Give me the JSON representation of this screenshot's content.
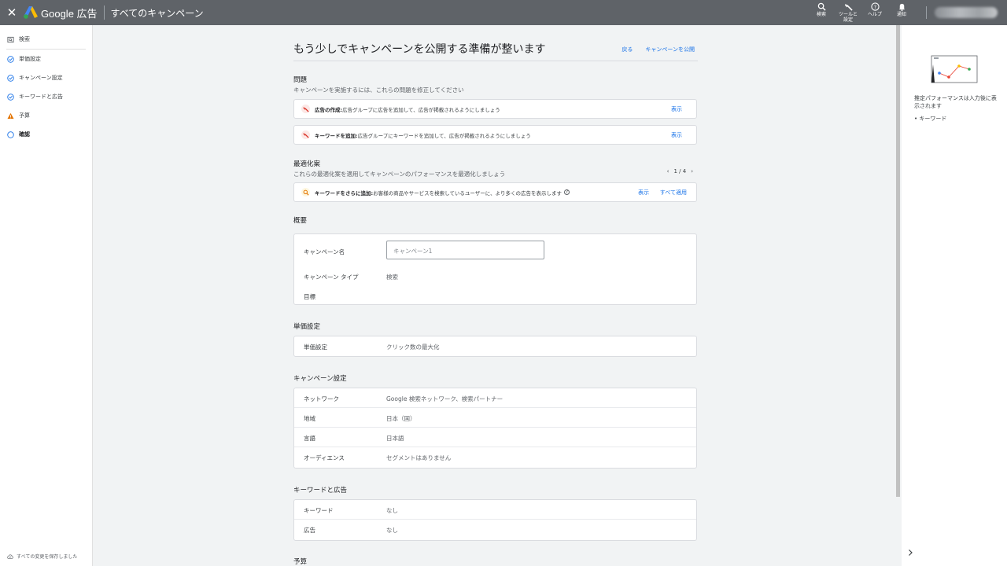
{
  "header": {
    "brand": "Google 広告",
    "title": "すべてのキャンペーン",
    "buttons": [
      {
        "line1": "検索",
        "line2": ""
      },
      {
        "line1": "ツールと",
        "line2": "設定"
      },
      {
        "line1": "ヘルプ",
        "line2": ""
      },
      {
        "line1": "通知",
        "line2": ""
      }
    ]
  },
  "nav": {
    "items": [
      {
        "label": "検索",
        "status": "search"
      },
      {
        "label": "単価設定",
        "status": "done"
      },
      {
        "label": "キャンペーン設定",
        "status": "done"
      },
      {
        "label": "キーワードと広告",
        "status": "done"
      },
      {
        "label": "予算",
        "status": "warning"
      },
      {
        "label": "確認",
        "status": "current"
      }
    ],
    "save_status": "すべての変更を保存しました"
  },
  "page": {
    "title": "もう少しでキャンペーンを公開する準備が整います",
    "back_link": "戻る",
    "publish_link": "キャンペーンを公開"
  },
  "issues": {
    "title": "問題",
    "subtitle": "キャンペーンを実施するには、これらの問題を修正してください",
    "items": [
      {
        "bold": "広告の作成:",
        "text": " 広告グループに広告を追加して、広告が掲載されるようにしましょう",
        "action": "表示"
      },
      {
        "bold": "キーワードを追加:",
        "text": " 広告グループにキーワードを追加して、広告が掲載されるようにしましょう",
        "action": "表示"
      }
    ]
  },
  "optimization": {
    "title": "最適化案",
    "subtitle": "これらの最適化案を適用してキャンペーンのパフォーマンスを最適化しましょう",
    "pager": "1 / 4",
    "item": {
      "bold": "キーワードをさらに追加:",
      "text": " お客様の商品やサービスを検索しているユーザーに、より多くの広告を表示します",
      "action1": "表示",
      "action2": "すべて適用"
    }
  },
  "summary": {
    "title": "概要",
    "campaign_name_label": "キャンペーン名",
    "campaign_name_placeholder": "キャンペーン1",
    "campaign_type_label": "キャンペーン タイプ",
    "campaign_type_value": "検索",
    "goal_label": "目標"
  },
  "bidding": {
    "title": "単価設定",
    "label": "単価設定",
    "value": "クリック数の最大化"
  },
  "campaign_settings": {
    "title": "キャンペーン設定",
    "rows": [
      {
        "label": "ネットワーク",
        "value": "Google 検索ネットワーク、検索パートナー"
      },
      {
        "label": "地域",
        "value": "日本（国）"
      },
      {
        "label": "言語",
        "value": "日本語"
      },
      {
        "label": "オーディエンス",
        "value": "セグメントはありません"
      }
    ]
  },
  "keywords_ads": {
    "title": "キーワードと広告",
    "rows": [
      {
        "label": "キーワード",
        "value": "なし"
      },
      {
        "label": "広告",
        "value": "なし"
      }
    ]
  },
  "budget": {
    "title": "予算"
  },
  "right_panel": {
    "text": "推定パフォーマンスは入力後に表示されます",
    "bullet": "キーワード"
  },
  "colors": {
    "header": "#5f6368",
    "link": "#1a73e8",
    "warning": "#e37400",
    "done": "#1a73e8",
    "error": "#d93025"
  }
}
